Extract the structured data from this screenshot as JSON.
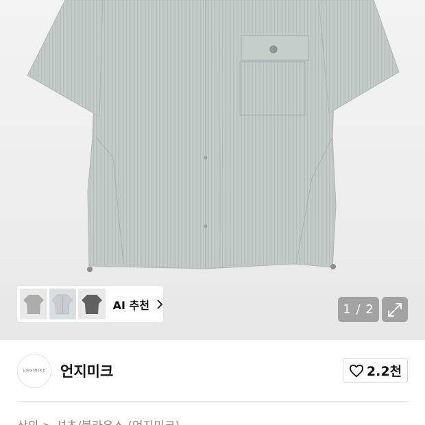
{
  "product_image": {
    "subject": "short-sleeve-shirt",
    "shirt_color": "#bfc7c4"
  },
  "thumbnails": [
    {
      "name": "thumb-1",
      "color": "#a9aca6"
    },
    {
      "name": "thumb-2",
      "color": "#c9ccd0"
    },
    {
      "name": "thumb-3",
      "color": "#5e615e"
    }
  ],
  "ai_recommend": {
    "label": "AI 추천",
    "icon": "chevron-right-icon"
  },
  "gallery": {
    "counter": "1 / 2",
    "expand_icon": "expand-icon"
  },
  "brand": {
    "name": "언지미크",
    "logo_text": "UNGIMIKE"
  },
  "like": {
    "count": "2.2천",
    "icon": "heart-icon"
  },
  "breadcrumb": {
    "text": "상의 > 셔츠/블라우스 (언지미크)"
  },
  "colors": {
    "overlay_button": "#969696",
    "text_primary": "#111111",
    "text_secondary": "#888888"
  }
}
